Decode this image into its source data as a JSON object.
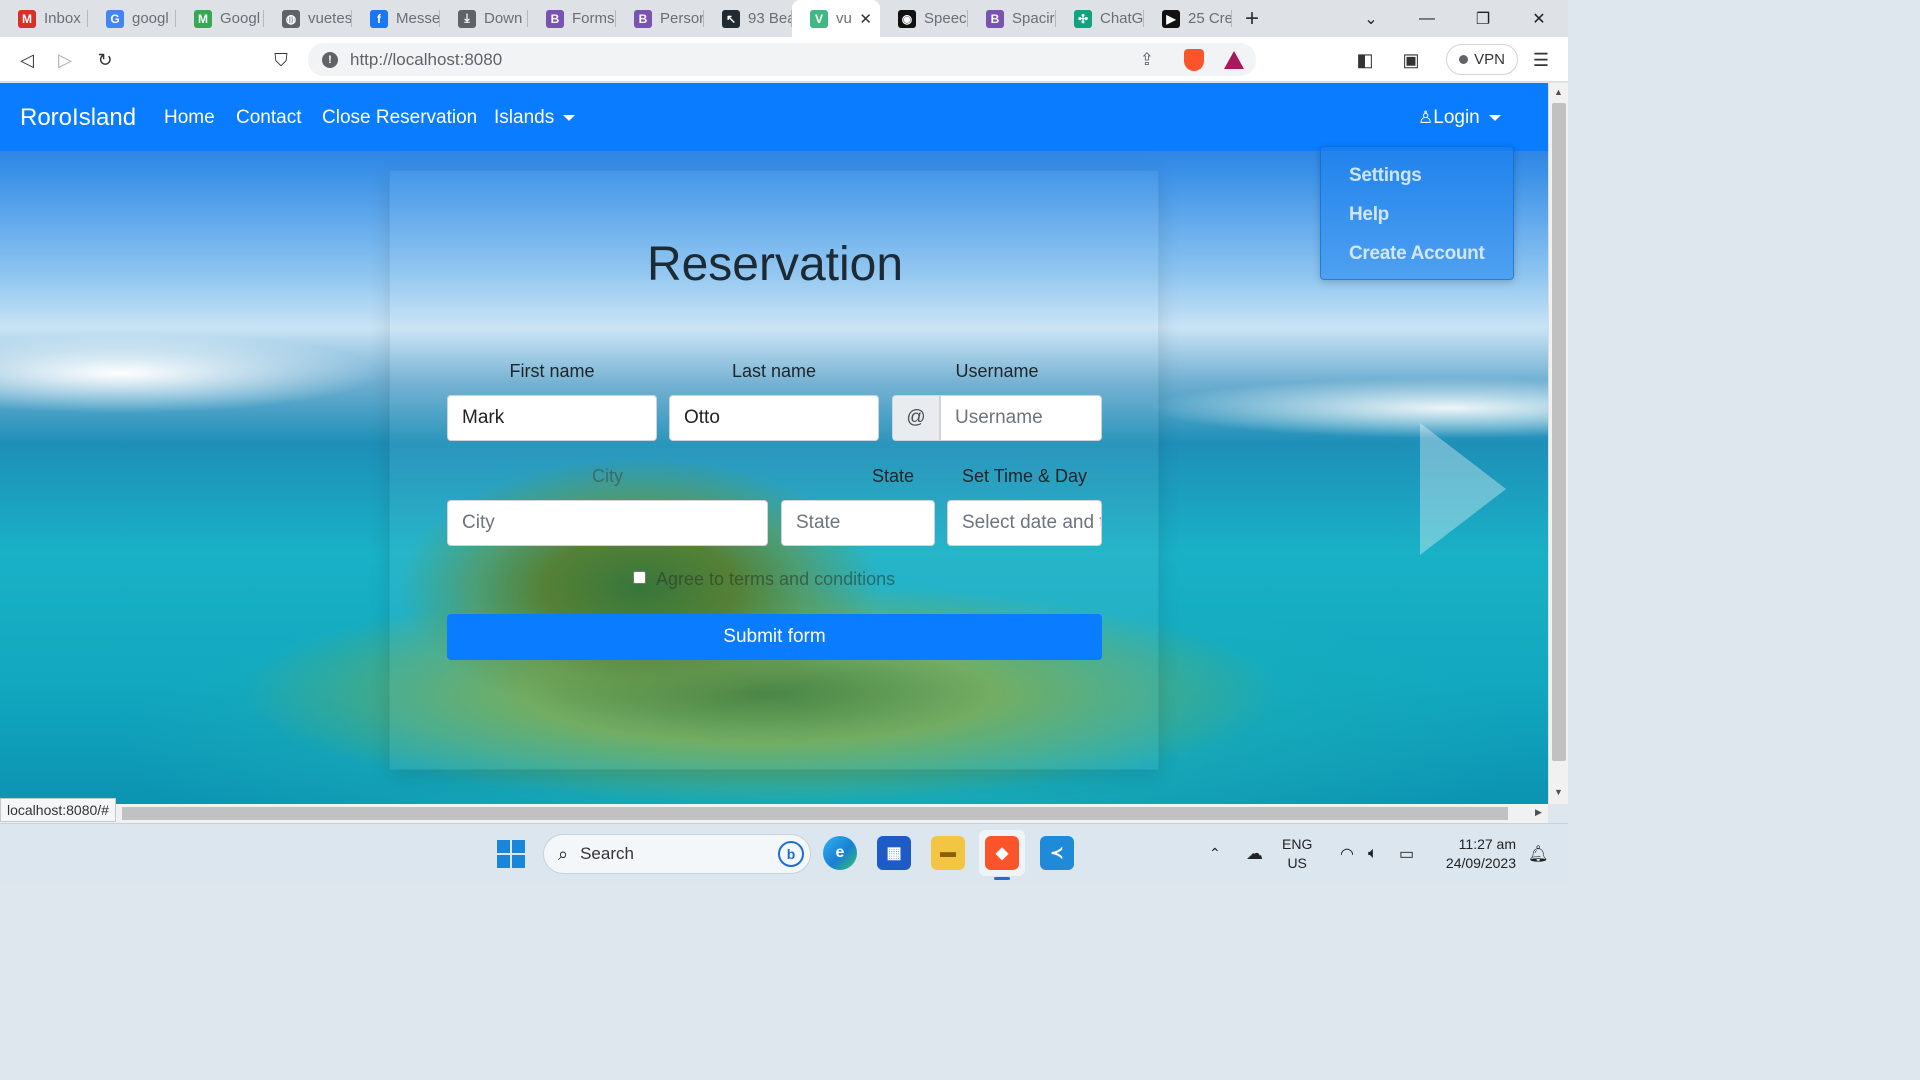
{
  "browser": {
    "tabs": [
      {
        "label": "Inbox",
        "icon": "gmail-icon",
        "color": "#d93025",
        "glyph": "M"
      },
      {
        "label": "googl",
        "icon": "google-icon",
        "color": "#4285f4",
        "glyph": "G"
      },
      {
        "label": "Googl",
        "icon": "google-meet-icon",
        "color": "#34a853",
        "glyph": "M"
      },
      {
        "label": "vuetes",
        "icon": "globe-icon",
        "color": "#5f6368",
        "glyph": "◍"
      },
      {
        "label": "Messe",
        "icon": "facebook-icon",
        "color": "#1877f2",
        "glyph": "f"
      },
      {
        "label": "Down",
        "icon": "download-icon",
        "color": "#5f6368",
        "glyph": "⤓"
      },
      {
        "label": "Forms",
        "icon": "bootstrap-icon",
        "color": "#7952b3",
        "glyph": "B"
      },
      {
        "label": "Persor",
        "icon": "bootstrap-icon",
        "color": "#7952b3",
        "glyph": "B"
      },
      {
        "label": "93 Bea",
        "icon": "cursor-icon",
        "color": "#1f2a33",
        "glyph": "↖"
      },
      {
        "label": "vu",
        "icon": "vue-icon",
        "color": "#41b883",
        "glyph": "V"
      },
      {
        "label": "Speec",
        "icon": "speedometer-icon",
        "color": "#111111",
        "glyph": "◉"
      },
      {
        "label": "Spacir",
        "icon": "bootstrap-icon",
        "color": "#7952b3",
        "glyph": "B"
      },
      {
        "label": "ChatG",
        "icon": "chatgpt-icon",
        "color": "#10a37f",
        "glyph": "✣"
      },
      {
        "label": "25 Cre",
        "icon": "video-icon",
        "color": "#111111",
        "glyph": "▶"
      }
    ],
    "url": "http://localhost:8080",
    "vpn_label": "VPN",
    "status_url": "localhost:8080/#"
  },
  "navbar": {
    "brand": "RoroIsland",
    "links": [
      "Home",
      "Contact",
      "Close Reservation",
      "Islands"
    ],
    "login": "Login",
    "accent": "#0a7cff"
  },
  "dropdown": {
    "items": [
      "Settings",
      "Help",
      "Create Account"
    ]
  },
  "form": {
    "title": "Reservation",
    "first_name": {
      "label": "First name",
      "value": "Mark"
    },
    "last_name": {
      "label": "Last name",
      "value": "Otto"
    },
    "username": {
      "label": "Username",
      "prefix": "@",
      "placeholder": "Username"
    },
    "city": {
      "label": "City",
      "placeholder": "City"
    },
    "state": {
      "label": "State",
      "placeholder": "State"
    },
    "datetime": {
      "label": "Set Time & Day",
      "placeholder": "Select date and time"
    },
    "terms": "Agree to terms and conditions",
    "submit": "Submit form"
  },
  "taskbar": {
    "search_placeholder": "Search",
    "language": "ENG",
    "region": "US",
    "time": "11:27 am",
    "date": "24/09/2023"
  }
}
